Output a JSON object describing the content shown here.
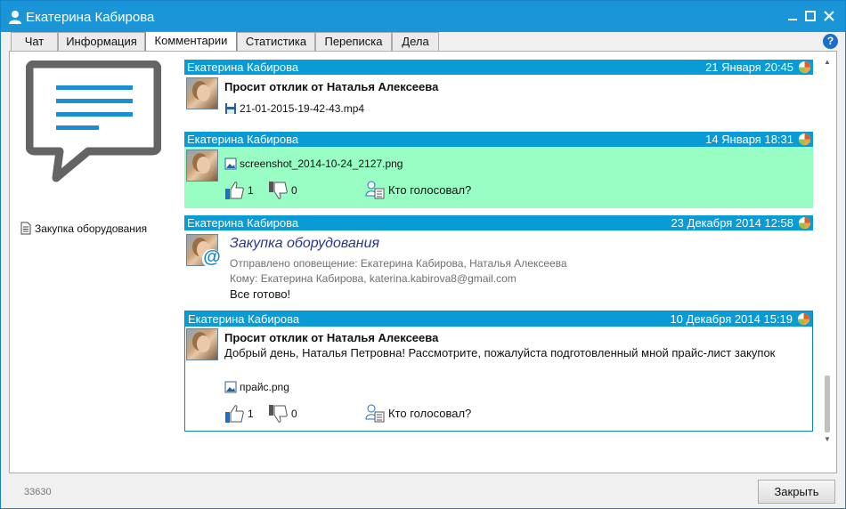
{
  "window": {
    "title": "Екатерина Кабирова",
    "minimize_icon": "minimize-icon",
    "maximize_icon": "maximize-icon",
    "close_icon": "close-icon"
  },
  "tabs": [
    {
      "label": "Чат",
      "active": false
    },
    {
      "label": "Информация",
      "active": false
    },
    {
      "label": "Комментарии",
      "active": true
    },
    {
      "label": "Статистика",
      "active": false
    },
    {
      "label": "Переписка",
      "active": false
    },
    {
      "label": "Дела",
      "active": false
    }
  ],
  "help_label": "?",
  "colors": {
    "titlebar": "#1a96d8",
    "comment_header": "#099bd6",
    "highlight": "#98fec4",
    "accent_text": "#26368f"
  },
  "sidebar": {
    "link_label": "Закупка оборудования"
  },
  "comments": [
    {
      "author": "Екатерина Кабирова",
      "date": "21 Января 20:45",
      "title": "Просит отклик от Наталья Алексеева",
      "attachment": "21-01-2015-19-42-43.mp4"
    },
    {
      "author": "Екатерина Кабирова",
      "date": "14 Января 18:31",
      "attachment": "screenshot_2014-10-24_2127.png",
      "likes": "1",
      "dislikes": "0",
      "who_voted": "Кто голосовал?"
    },
    {
      "author": "Екатерина Кабирова",
      "date": "23 Декабря 2014 12:58",
      "subject": "Закупка оборудования",
      "notification": "Отправлено оповещение: Екатерина Кабирова, Наталья Алексеева",
      "recipients": "Кому: Екатерина Кабирова, katerina.kabirova8@gmail.com",
      "body": "Все готово!"
    },
    {
      "author": "Екатерина Кабирова",
      "date": "10 Декабря 2014 15:19",
      "title": "Просит отклик от Наталья Алексеева",
      "body": "Добрый день, Наталья Петровна! Рассмотрите, пожалуйста подготовленный мной прайс-лист закупок",
      "attachment": "прайс.png",
      "likes": "1",
      "dislikes": "0",
      "who_voted": "Кто голосовал?"
    }
  ],
  "footer": {
    "record_id": "33630",
    "close_label": "Закрыть"
  }
}
